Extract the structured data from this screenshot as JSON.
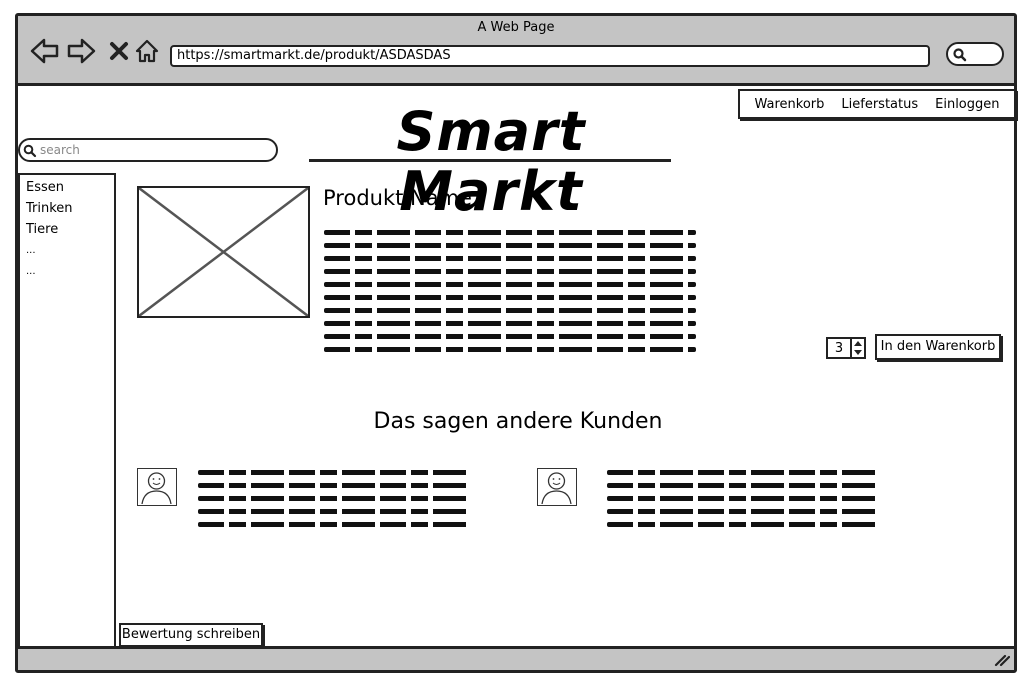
{
  "browser": {
    "window_title": "A Web Page",
    "url": "https://smartmarkt.de/produkt/ASDASDAS",
    "icons": [
      "back-arrow-icon",
      "forward-arrow-icon",
      "close-x-icon",
      "home-icon",
      "search-icon",
      "resize-grip-icon"
    ]
  },
  "header": {
    "logo": "Smart Markt",
    "nav": {
      "cart": "Warenkorb",
      "delivery": "Lieferstatus",
      "login": "Einloggen"
    },
    "search_placeholder": "search"
  },
  "sidebar": {
    "items": [
      "Essen",
      "Trinken",
      "Tiere",
      "...",
      "..."
    ]
  },
  "product": {
    "name": "Produkt Name",
    "quantity": "3",
    "add_to_cart": "In den Warenkorb"
  },
  "reviews": {
    "title": "Das sagen andere Kunden",
    "write_review": "Bewertung schreiben"
  },
  "colors": {
    "chrome": "#c4c4c4",
    "ink": "#222222"
  }
}
